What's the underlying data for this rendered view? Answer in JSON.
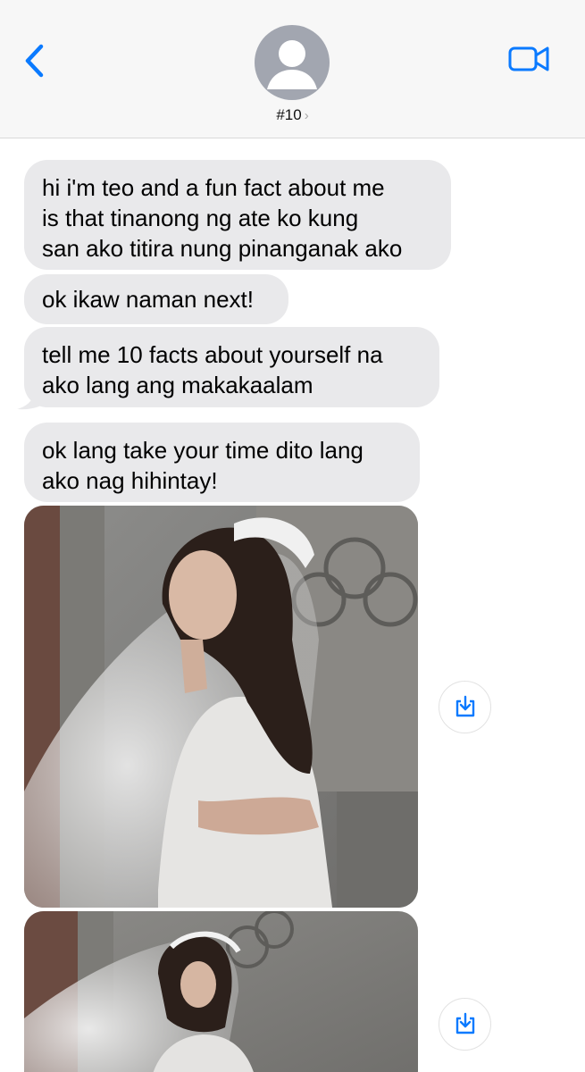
{
  "header": {
    "contact_name": "#10",
    "chevron_glyph": "›"
  },
  "messages": [
    {
      "type": "text",
      "text": "hi i'm teo and a fun fact about me\nis that tinanong ng ate ko kung\nsan ako titira nung pinanganak ako"
    },
    {
      "type": "text",
      "text": "ok ikaw naman next!"
    },
    {
      "type": "text",
      "text": "tell me 10 facts about yourself na\nako lang ang makakaalam"
    },
    {
      "type": "text",
      "text": "ok lang take your time dito lang\nako nag hihintay!"
    },
    {
      "type": "image",
      "icon": "photo-bride-veil"
    },
    {
      "type": "image",
      "icon": "photo-bride-veil"
    }
  ],
  "colors": {
    "accent": "#0a7aff",
    "incoming_bubble": "#e9e9eb",
    "header_bg": "#f7f7f7",
    "avatar_bg": "#a2a6b0"
  },
  "icons": {
    "back": "chevron-left-icon",
    "video": "video-camera-icon",
    "save": "save-download-icon",
    "avatar": "person-silhouette-icon"
  }
}
